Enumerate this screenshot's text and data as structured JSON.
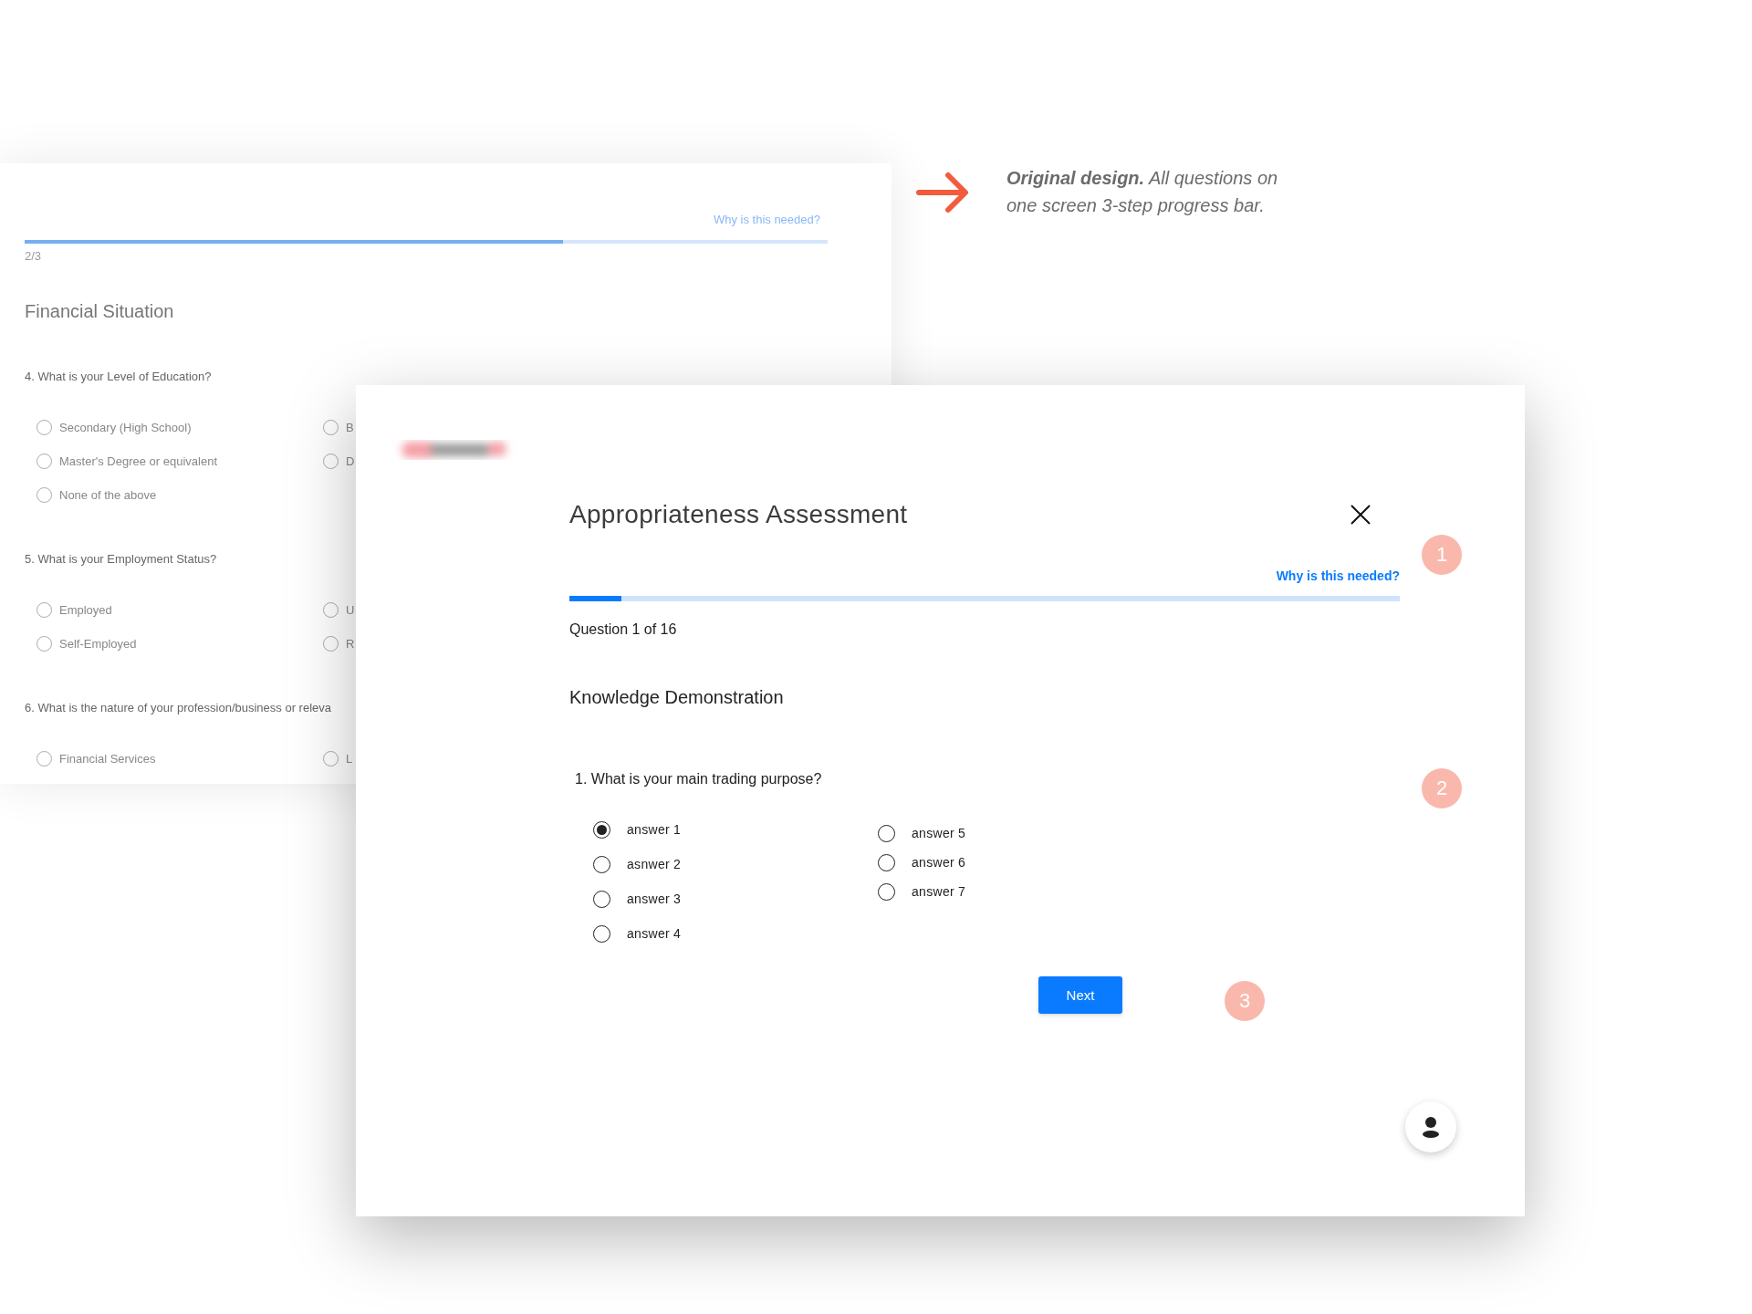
{
  "annotation": {
    "caption": "**Original design.** All questions on one screen 3-step progress bar."
  },
  "original_screen": {
    "help_link": "Why is this needed?",
    "progress": {
      "level": 0.67
    },
    "step": "2/3",
    "section_title": "Financial Situation",
    "questions": [
      {
        "text": "4. What is your Level of Education?",
        "options_left": [
          {
            "label": "Secondary (High School)",
            "selected": false
          },
          {
            "label": "Master's Degree or equivalent",
            "selected": false
          },
          {
            "label": "None of the above",
            "selected": false
          }
        ],
        "options_right": [
          {
            "label": "B",
            "selected": false
          },
          {
            "label": "D",
            "selected": false
          }
        ]
      },
      {
        "text": "5. What is your Employment Status?",
        "options_left": [
          {
            "label": "Employed",
            "selected": false
          },
          {
            "label": "Self-Employed",
            "selected": false
          }
        ],
        "options_right": [
          {
            "label": "U",
            "selected": false
          },
          {
            "label": "R",
            "selected": false
          }
        ]
      },
      {
        "text": "6. What is the nature of your profession/business or releva",
        "options_left": [
          {
            "label": "Financial Services",
            "selected": false
          }
        ],
        "options_right": [
          {
            "label": "L",
            "selected": false
          }
        ]
      }
    ]
  },
  "redesign": {
    "title": "Appropriateness Assessment",
    "help_link": "Why is this needed?",
    "progress": {
      "level": 0.0625
    },
    "counter": "Question 1 of 16",
    "section_title": "Knowledge Demonstration",
    "question": "1. What is your main trading purpose?",
    "answers_left": [
      {
        "label": "answer 1",
        "selected": true
      },
      {
        "label": "asnwer 2",
        "selected": false
      },
      {
        "label": "answer 3",
        "selected": false
      },
      {
        "label": "answer 4",
        "selected": false
      }
    ],
    "answers_right": [
      {
        "label": "answer 5",
        "selected": false
      },
      {
        "label": "answer 6",
        "selected": false
      },
      {
        "label": "answer 7",
        "selected": false
      }
    ],
    "next_button": "Next",
    "markers": [
      "1",
      "2",
      "3"
    ]
  }
}
